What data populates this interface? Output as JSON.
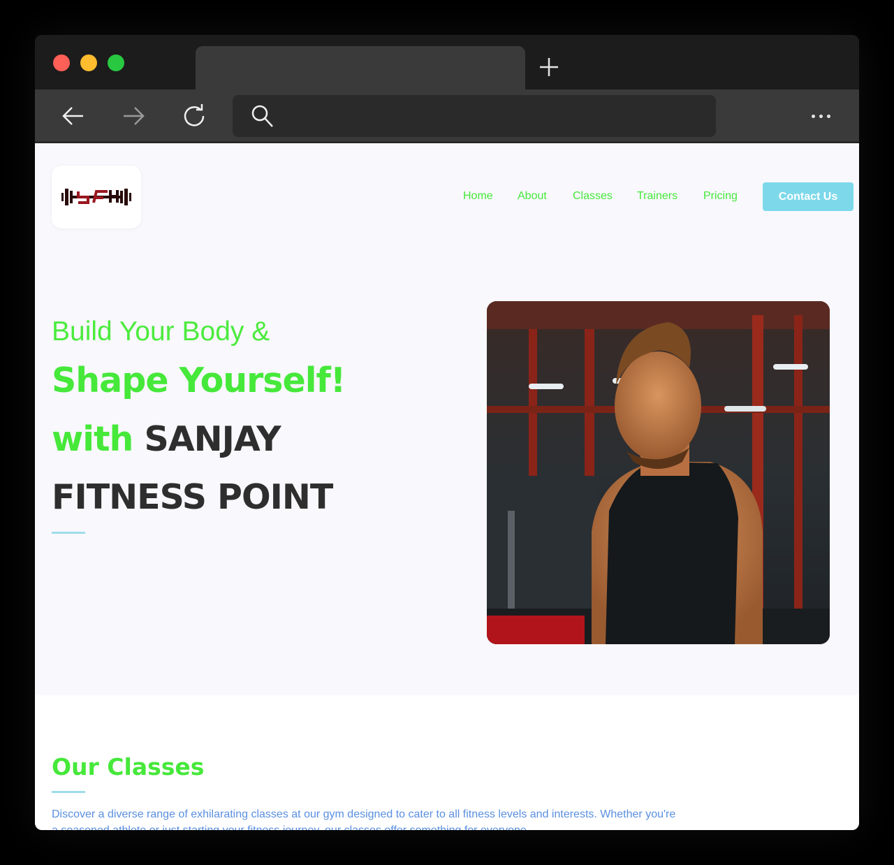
{
  "browser": {
    "tab_title": "",
    "url": ""
  },
  "site": {
    "nav": {
      "home": "Home",
      "about": "About",
      "classes": "Classes",
      "trainers": "Trainers",
      "pricing": "Pricing",
      "contact": "Contact Us"
    },
    "hero": {
      "line1": "Build Your Body &",
      "line2": "Shape Yourself!",
      "line3_green": "with",
      "line3_dark": "SANJAY",
      "line4": "FITNESS POINT"
    },
    "classes": {
      "title": "Our Classes",
      "description": "Discover a diverse range of exhilarating classes at our gym designed to cater to all fitness levels and interests. Whether you're a seasoned athlete or just starting your fitness journey, our classes offer something for everyone."
    }
  },
  "colors": {
    "accent_green": "#46e83a",
    "accent_cyan": "#7dd9ea",
    "dark_text": "#2e2e2e",
    "link_blue": "#5a8fe0"
  }
}
